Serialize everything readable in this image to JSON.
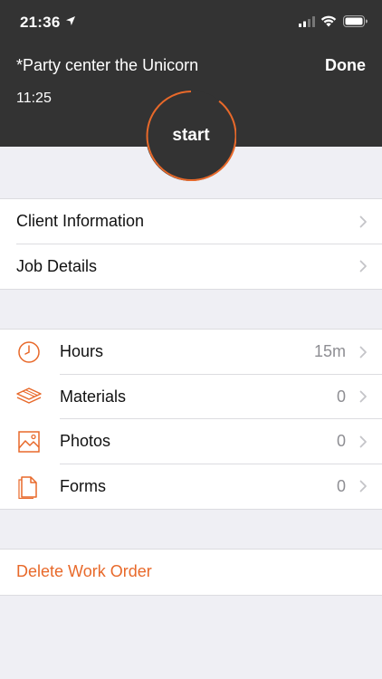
{
  "status_bar": {
    "time": "21:36"
  },
  "header": {
    "job_title": "*Party center the Unicorn",
    "done_label": "Done",
    "elapsed_time": "11:25",
    "start_label": "start",
    "background_color": "#333333",
    "accent_color": "#e8692a"
  },
  "info_section": {
    "items": [
      {
        "label": "Client Information",
        "icon": "chevron-right-icon"
      },
      {
        "label": "Job Details",
        "icon": "chevron-right-icon"
      }
    ]
  },
  "work_section": {
    "items": [
      {
        "label": "Hours",
        "value": "15m",
        "icon": "clock-icon"
      },
      {
        "label": "Materials",
        "value": "0",
        "icon": "layers-icon"
      },
      {
        "label": "Photos",
        "value": "0",
        "icon": "photo-icon"
      },
      {
        "label": "Forms",
        "value": "0",
        "icon": "document-icon"
      }
    ]
  },
  "delete_section": {
    "label": "Delete Work Order"
  }
}
